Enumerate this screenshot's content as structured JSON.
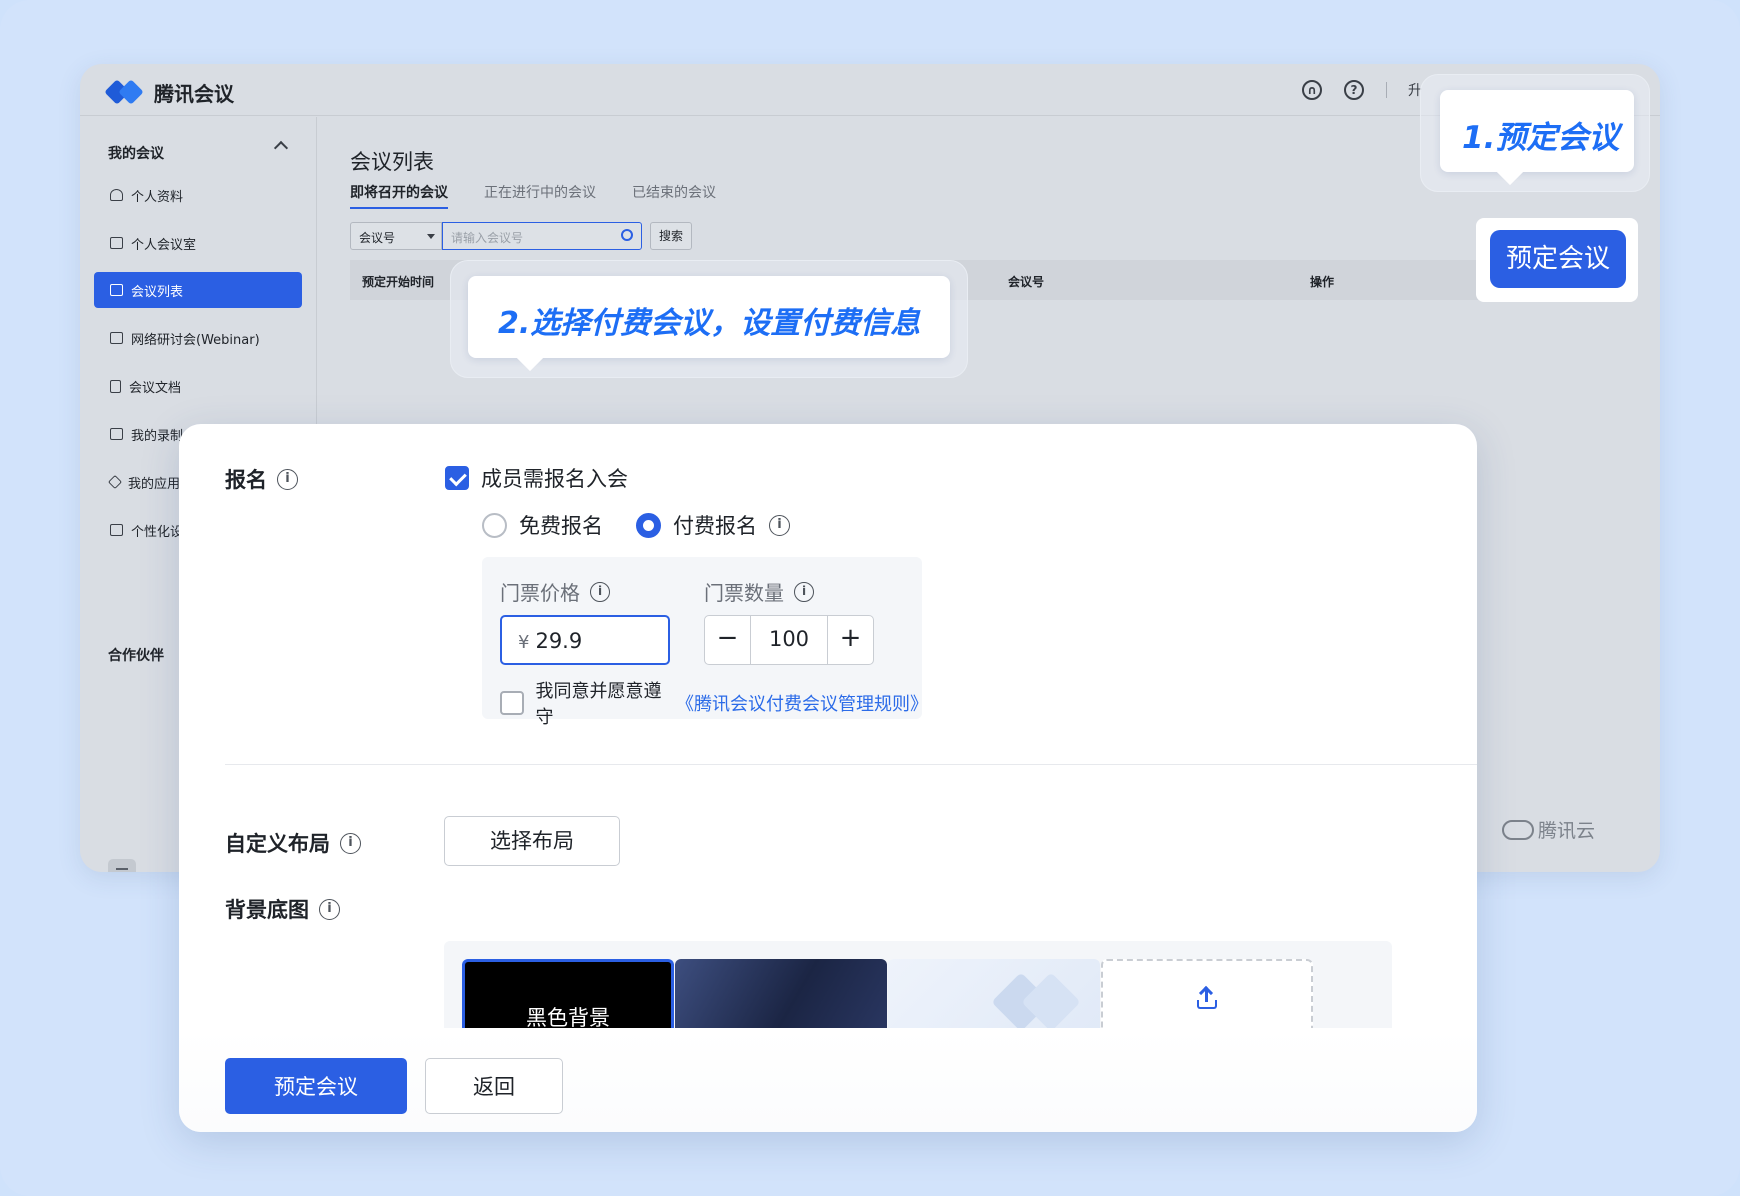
{
  "app": {
    "brand": "腾讯会议",
    "header_truncated": "升",
    "sidebar": {
      "section_title": "我的会议",
      "items": [
        {
          "label": "个人资料",
          "icon": "user-icon"
        },
        {
          "label": "个人会议室",
          "icon": "monitor-icon"
        },
        {
          "label": "会议列表",
          "icon": "list-icon",
          "active": true
        },
        {
          "label": "网络研讨会(Webinar)",
          "icon": "webinar-icon"
        },
        {
          "label": "会议文档",
          "icon": "document-icon"
        },
        {
          "label": "我的录制",
          "icon": "video-icon"
        },
        {
          "label": "我的应用",
          "icon": "layers-icon"
        },
        {
          "label": "个性化设置",
          "icon": "brush-icon"
        }
      ],
      "partner": "合作伙伴"
    },
    "main": {
      "title": "会议列表",
      "tabs": [
        {
          "label": "即将召开的会议",
          "active": true
        },
        {
          "label": "正在进行中的会议"
        },
        {
          "label": "已结束的会议"
        }
      ],
      "filter": {
        "select_value": "会议号",
        "input_placeholder": "请输入会议号",
        "search_label": "搜索"
      },
      "table_headers": [
        "预定开始时间",
        "会议号",
        "操作"
      ]
    },
    "footer_brand": "腾讯云"
  },
  "callouts": {
    "step1": "1.预定会议",
    "step2": "2.选择付费会议，设置付费信息",
    "book_button": "预定会议"
  },
  "form": {
    "registration": {
      "label": "报名",
      "require_checkbox": {
        "label": "成员需报名入会",
        "checked": true
      },
      "options": [
        {
          "label": "免费报名",
          "selected": false
        },
        {
          "label": "付费报名",
          "selected": true
        }
      ],
      "price_label": "门票价格",
      "price_currency": "¥",
      "price_value": "29.9",
      "quantity_label": "门票数量",
      "quantity_value": "100",
      "agree_text": "我同意并愿意遵守",
      "agree_link": "《腾讯会议付费会议管理规则》",
      "agree_checked": false
    },
    "layout": {
      "label": "自定义布局",
      "button": "选择布局"
    },
    "background": {
      "label": "背景底图",
      "thumbs": [
        {
          "label": "黑色背景",
          "selected": true
        },
        {
          "label": ""
        },
        {
          "label": ""
        },
        {
          "label": "",
          "icon": "upload-icon"
        }
      ]
    },
    "actions": {
      "submit": "预定会议",
      "back": "返回"
    }
  },
  "colors": {
    "accent": "#2b5fe3",
    "callout_text": "#1d6ef5",
    "page_bg": "#d2e3fb"
  }
}
